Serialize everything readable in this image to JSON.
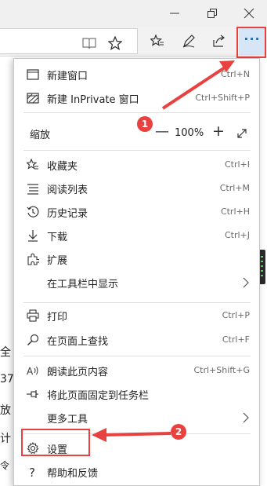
{
  "menu": {
    "new_window": {
      "label": "新建窗口",
      "shortcut": "Ctrl+N"
    },
    "new_inprivate": {
      "label": "新建 InPrivate 窗口",
      "shortcut": "Ctrl+Shift+P"
    },
    "zoom": {
      "label": "缩放",
      "minus": "—",
      "value": "100%",
      "plus": "+"
    },
    "favorites": {
      "label": "收藏夹",
      "shortcut": "Ctrl+I"
    },
    "reading_list": {
      "label": "阅读列表",
      "shortcut": "Ctrl+M"
    },
    "history": {
      "label": "历史记录",
      "shortcut": "Ctrl+H"
    },
    "downloads": {
      "label": "下载",
      "shortcut": "Ctrl+J"
    },
    "extensions": {
      "label": "扩展"
    },
    "show_in_toolbar": {
      "label": "在工具栏中显示"
    },
    "print": {
      "label": "打印",
      "shortcut": "Ctrl+P"
    },
    "find_on_page": {
      "label": "在页面上查找",
      "shortcut": "Ctrl+F"
    },
    "read_aloud": {
      "label": "朗读此页内容",
      "shortcut": "Ctrl+Shift+G"
    },
    "pin_to_taskbar": {
      "label": "将此页面固定到任务栏"
    },
    "more_tools": {
      "label": "更多工具"
    },
    "settings": {
      "label": "设置"
    },
    "help": {
      "label": "帮助和反馈"
    }
  },
  "toolbar": {
    "more_label": "···"
  },
  "background_page": {
    "fragments": [
      "全",
      "37",
      "放",
      "计",
      "令"
    ]
  },
  "annotations": {
    "badge_1": "1",
    "badge_2": "2"
  },
  "colors": {
    "annotation_red": "#e8413f",
    "more_button_bg": "#d6e6f6",
    "accent_blue": "#1f6fb5"
  }
}
